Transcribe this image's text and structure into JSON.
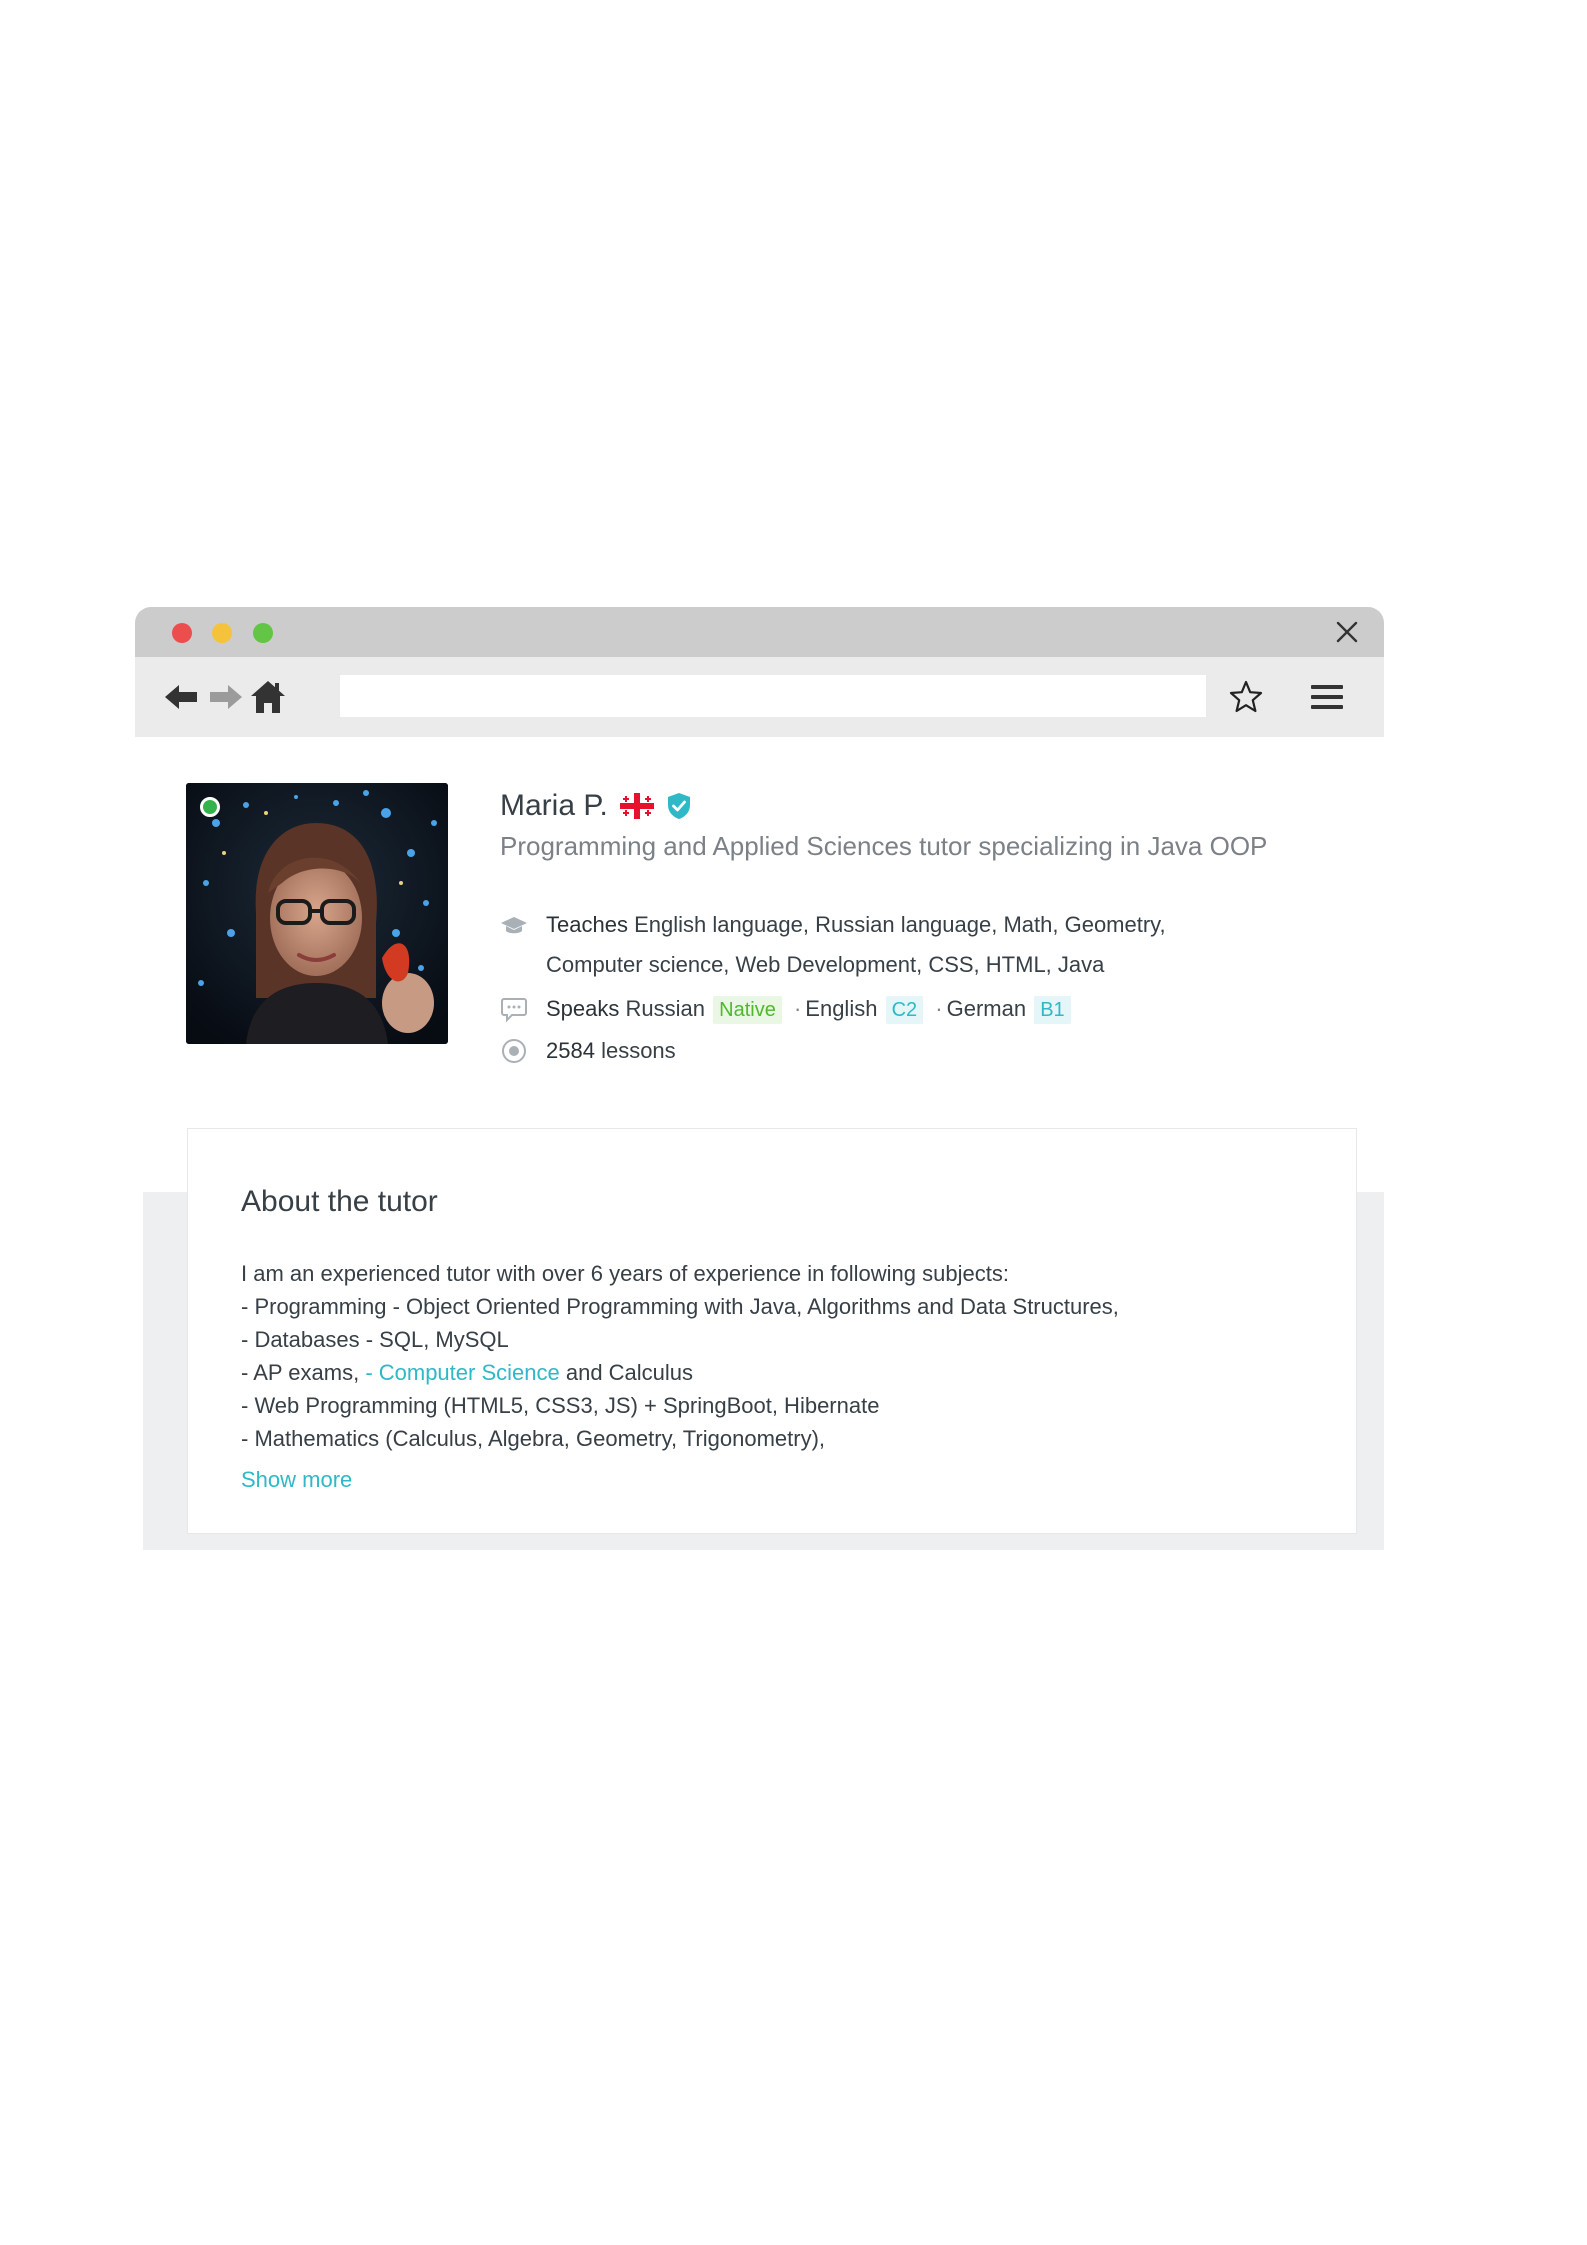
{
  "browser": {
    "url": "",
    "colors": {
      "close": "#ec4e4e",
      "minimize": "#f5c33b",
      "maximize": "#62c545"
    },
    "icons": [
      "back-arrow-icon",
      "forward-arrow-icon",
      "home-icon",
      "star-icon",
      "hamburger-menu-icon",
      "close-icon"
    ]
  },
  "profile": {
    "name": "Maria P.",
    "country_flag": "georgia-flag-icon",
    "verified": true,
    "online": true,
    "headline": "Programming and Applied Sciences tutor specializing in Java OOP",
    "teaches_label": "Teaches",
    "teaches_line1": "English language, Russian language, Math, Geometry,",
    "teaches_line2": "Computer science, Web Development, CSS, HTML, Java",
    "speaks_label": "Speaks",
    "languages": [
      {
        "name": "Russian",
        "level": "Native"
      },
      {
        "name": "English",
        "level": "C2"
      },
      {
        "name": "German",
        "level": "B1"
      }
    ],
    "separator": "·",
    "lessons_count": "2584",
    "lessons_label": "lessons"
  },
  "about": {
    "title": "About the tutor",
    "lines": [
      "I am an experienced tutor with over 6 years of experience in following subjects:",
      "- Programming - Object Oriented Programming with Java, Algorithms and Data Structures,",
      "- Databases - SQL, MySQL",
      "- AP exams, ",
      "- Web Programming (HTML5, CSS3, JS) + SpringBoot, Hibernate",
      "- Mathematics (Calculus, Algebra, Geometry, Trigonometry),"
    ],
    "ap_link": "- Computer Science",
    "ap_suffix": " and Calculus",
    "show_more": "Show more"
  },
  "colors": {
    "accent": "#2fb9c6",
    "native_green": "#4fb82d",
    "online_green": "#35b24b"
  }
}
